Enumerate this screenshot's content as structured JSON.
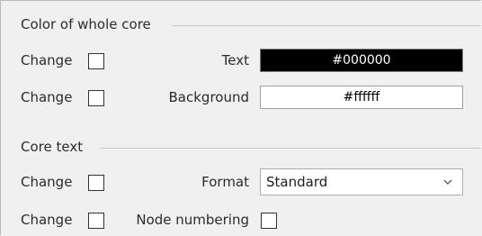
{
  "group_whole": {
    "title": "Color of whole core",
    "text_row": {
      "change_label": "Change",
      "field_label": "Text",
      "color_value": "#000000"
    },
    "background_row": {
      "change_label": "Change",
      "field_label": "Background",
      "color_value": "#ffffff"
    }
  },
  "group_text": {
    "title": "Core text",
    "format_row": {
      "change_label": "Change",
      "field_label": "Format",
      "selected_value": "Standard"
    },
    "numbering_row": {
      "change_label": "Change",
      "field_label": "Node numbering"
    }
  },
  "colors": {
    "text_swatch": "#000000",
    "background_swatch": "#ffffff"
  },
  "icons": {
    "dropdown": "chevron-down-icon"
  }
}
